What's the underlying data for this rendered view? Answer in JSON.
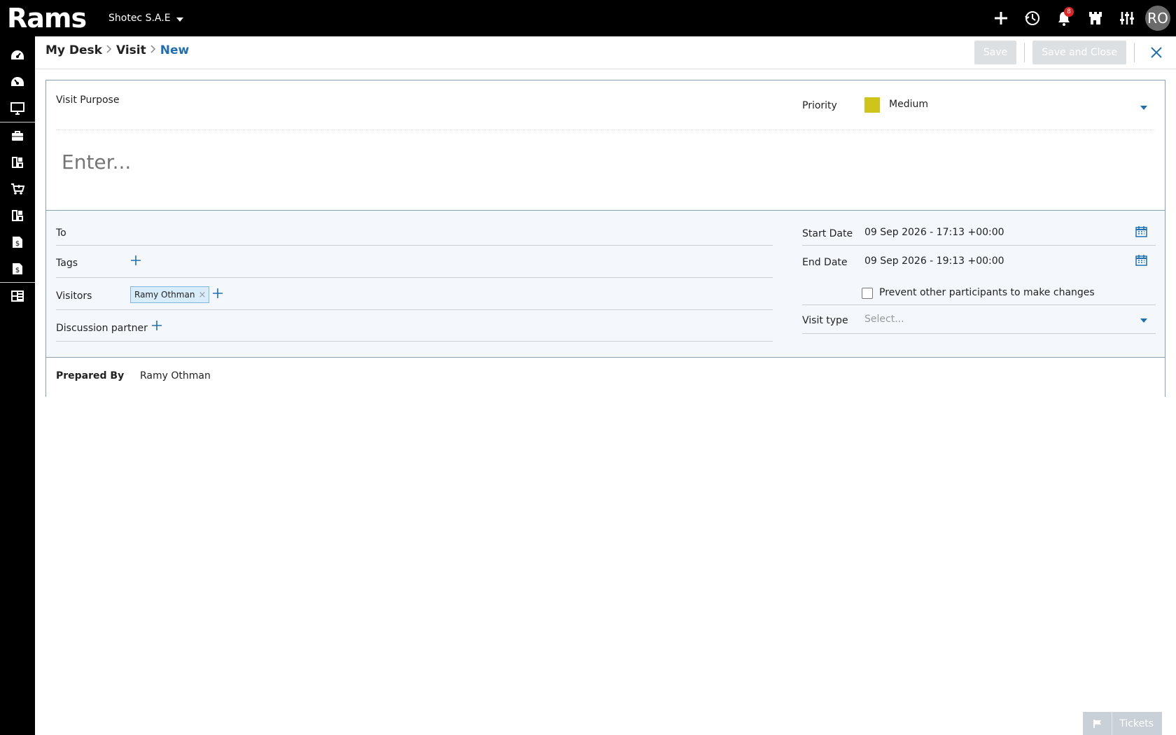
{
  "app": {
    "logo_text": "Rams",
    "company": "Shotec S.A.E"
  },
  "topbar": {
    "icons": [
      "plus-icon",
      "history-icon",
      "bell-icon",
      "castle-icon",
      "sliders-icon"
    ],
    "notification_count": "8",
    "avatar_initials": "RO"
  },
  "sidebar": {
    "icons": [
      "dashboard-icon",
      "dashboard-alt-icon",
      "monitor-icon",
      "briefcase-icon",
      "modules-icon",
      "cart-icon",
      "modules-alt-icon",
      "invoice-icon",
      "invoice-alt-icon",
      "report-grid-icon"
    ]
  },
  "breadcrumb": {
    "root": "My Desk",
    "section": "Visit",
    "current": "New"
  },
  "actions": {
    "save": "Save",
    "save_close": "Save and Close"
  },
  "form": {
    "visit_purpose_label": "Visit Purpose",
    "visit_purpose_placeholder": "Enter...",
    "priority_label": "Priority",
    "priority_value": "Medium",
    "priority_color": "#cfc41a",
    "to_label": "To",
    "tags_label": "Tags",
    "visitors_label": "Visitors",
    "visitor_tag": "Ramy Othman",
    "discussion_label": "Discussion partner",
    "start_label": "Start Date",
    "start_value": "09 Sep 2026 - 17:13 +00:00",
    "end_label": "End Date",
    "end_value": "09 Sep 2026 - 19:13 +00:00",
    "prevent_label": "Prevent other participants to make changes",
    "visit_type_label": "Visit type",
    "visit_type_placeholder": "Select...",
    "prepared_label": "Prepared By",
    "prepared_value": "Ramy Othman"
  },
  "tickets": {
    "label": "Tickets"
  },
  "colors": {
    "accent": "#1f6fb2",
    "panel_border": "#8aa0b4",
    "section_bg": "#f4f8fc"
  }
}
